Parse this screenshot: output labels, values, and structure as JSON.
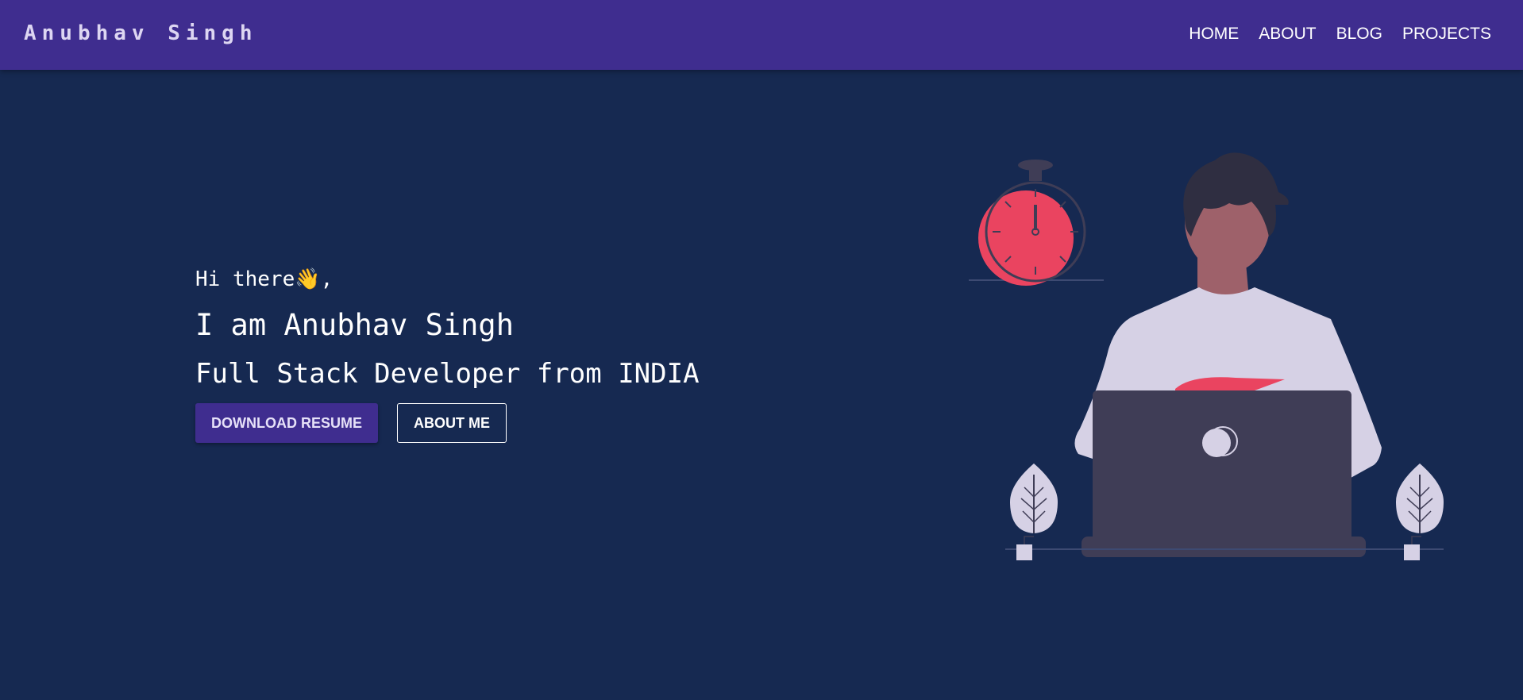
{
  "navbar": {
    "brand": "Anubhav Singh",
    "links": [
      "HOME",
      "ABOUT",
      "BLOG",
      "PROJECTS"
    ]
  },
  "hero": {
    "greeting": "Hi there👋,",
    "headline": "I am Anubhav Singh",
    "subheadline": "Full Stack Developer from INDIA",
    "primary_button": "DOWNLOAD RESUME",
    "secondary_button": "ABOUT ME"
  },
  "illustration": {
    "icon": "developer-with-laptop-illustration"
  },
  "colors": {
    "navbar_bg": "#3f2d8f",
    "page_bg": "#162951",
    "accent_red": "#ea4460",
    "laptop": "#3f3d56",
    "shirt": "#d6d1e5"
  }
}
